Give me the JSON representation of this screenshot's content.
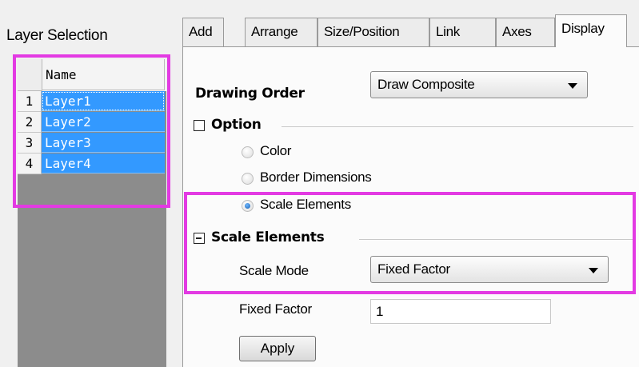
{
  "layer_panel": {
    "title": "Layer Selection",
    "column_header": "Name",
    "rows": [
      {
        "num": "1",
        "name": "Layer1"
      },
      {
        "num": "2",
        "name": "Layer2"
      },
      {
        "num": "3",
        "name": "Layer3"
      },
      {
        "num": "4",
        "name": "Layer4"
      }
    ]
  },
  "tabs": [
    "Add",
    "Arrange",
    "Size/Position",
    "Link",
    "Axes",
    "Display"
  ],
  "active_tab": "Display",
  "display": {
    "drawing_order_label": "Drawing Order",
    "drawing_order_value": "Draw Composite",
    "option_group": "Option",
    "radios": [
      {
        "label": "Color",
        "selected": false
      },
      {
        "label": "Border Dimensions",
        "selected": false
      },
      {
        "label": "Scale Elements",
        "selected": true
      }
    ],
    "scale_group": "Scale Elements",
    "scale_mode_label": "Scale Mode",
    "scale_mode_value": "Fixed Factor",
    "fixed_factor_label": "Fixed Factor",
    "fixed_factor_value": "1",
    "apply_label": "Apply"
  },
  "colors": {
    "highlight": "#e33ae3",
    "selection": "#3399ff"
  }
}
